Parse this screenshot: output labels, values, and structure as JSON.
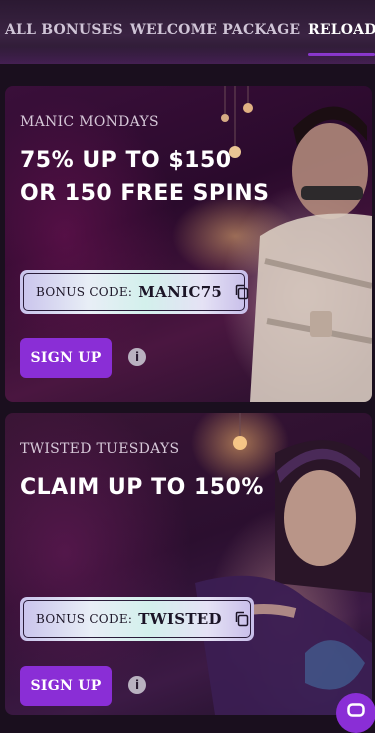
{
  "tabs": [
    {
      "label": "ALL BONUSES"
    },
    {
      "label": "WELCOME PACKAGE"
    },
    {
      "label": "RELOAD",
      "active": true
    }
  ],
  "promos": [
    {
      "eyebrow": "MANIC MONDAYS",
      "headline_lines": [
        "75% UP TO $150",
        "OR 150 FREE SPINS"
      ],
      "bonus_code_label": "BONUS CODE:",
      "bonus_code": "MANIC75",
      "cta": "SIGN UP",
      "info_glyph": "i"
    },
    {
      "eyebrow": "TWISTED TUESDAYS",
      "headline_lines": [
        "CLAIM UP TO 150%"
      ],
      "bonus_code_label": "BONUS CODE:",
      "bonus_code": "TWISTED",
      "cta": "SIGN UP",
      "info_glyph": "i"
    }
  ],
  "colors": {
    "accent": "#8a2ed6",
    "tab_underline": "#9b3df0",
    "background": "#1a0f1e"
  },
  "icons": {
    "copy": "copy-icon",
    "info": "info-icon",
    "chat": "chat-icon"
  }
}
